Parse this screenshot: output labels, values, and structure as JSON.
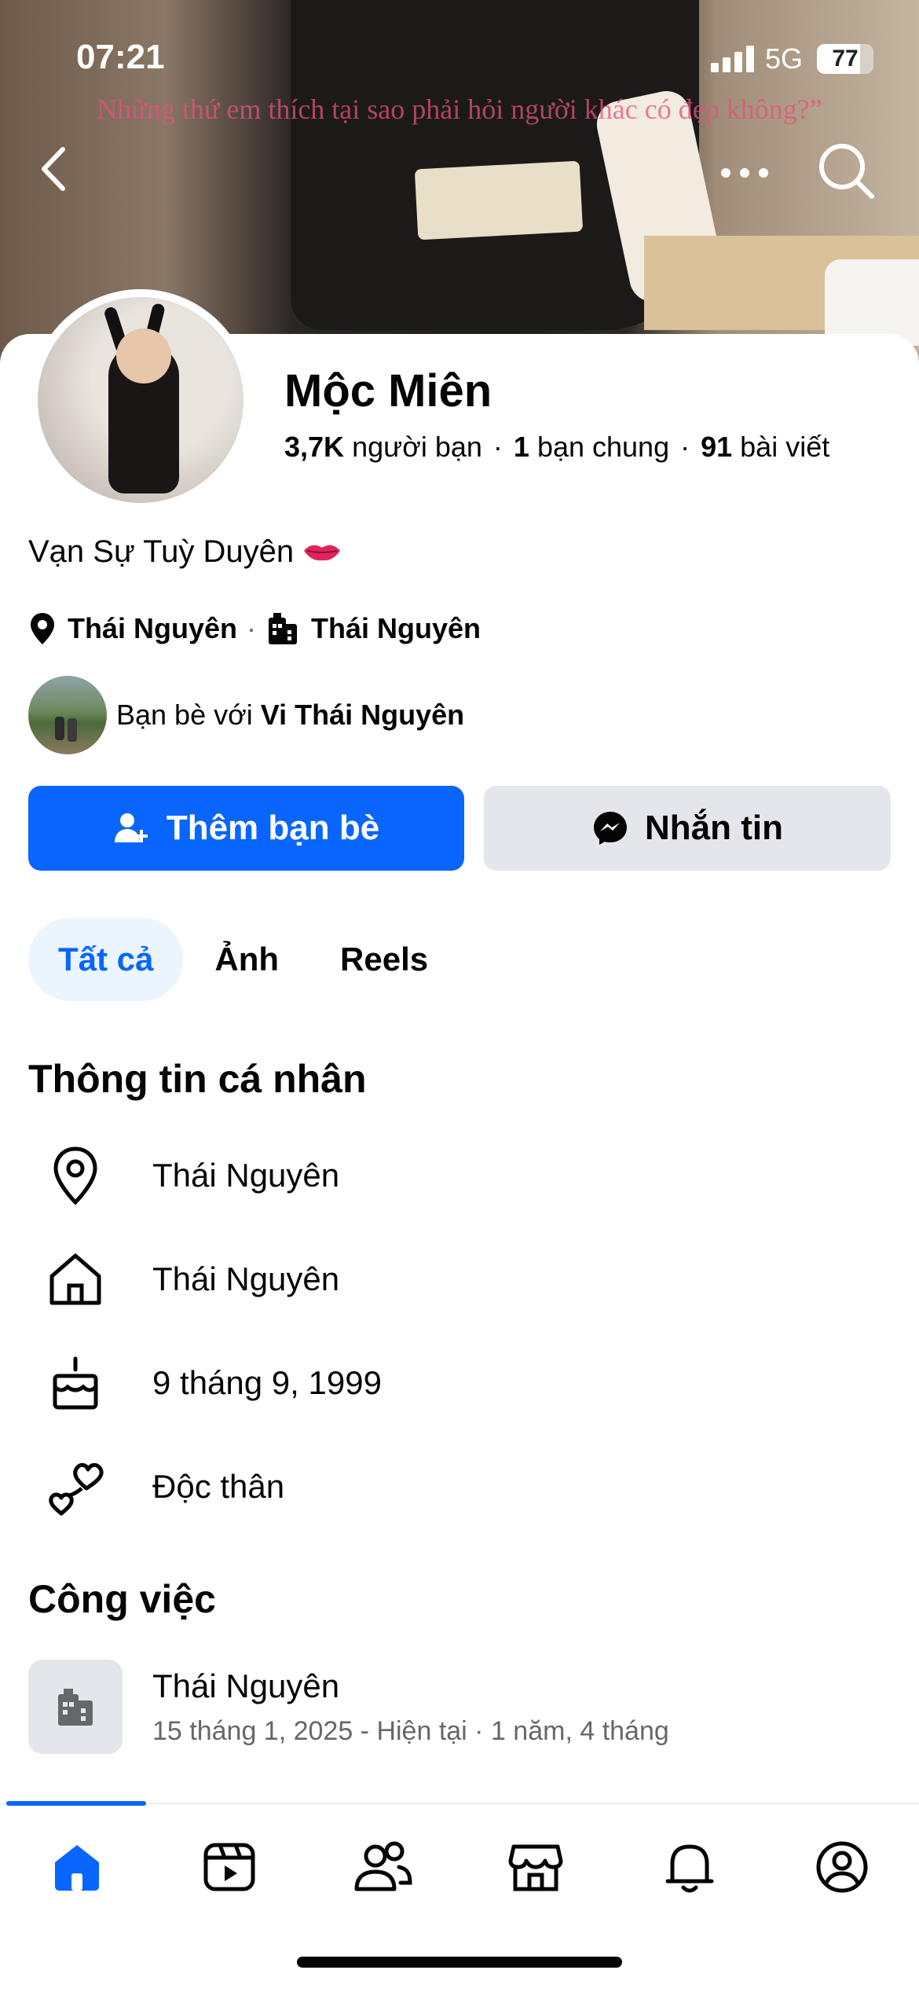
{
  "status_bar": {
    "time": "07:21",
    "network": "5G",
    "battery": "77"
  },
  "cover": {
    "caption": "Những thứ em thích tại sao phải hỏi người khác có đẹp không?”"
  },
  "profile": {
    "name": "Mộc Miên",
    "friends_count": "3,7K",
    "friends_label": "người bạn",
    "mutual_count": "1",
    "mutual_label": "bạn chung",
    "posts_count": "91",
    "posts_label": "bài viết",
    "bio": "Vạn Sự Tuỳ Duyên",
    "location": "Thái Nguyên",
    "workplace": "Thái Nguyên",
    "friends_with_prefix": "Bạn bè với",
    "friends_with_name": "Vi Thái Nguyên"
  },
  "actions": {
    "add_friend": "Thêm bạn bè",
    "message": "Nhắn tin"
  },
  "tabs": [
    {
      "label": "Tất cả",
      "active": true
    },
    {
      "label": "Ảnh",
      "active": false
    },
    {
      "label": "Reels",
      "active": false
    }
  ],
  "personal_info": {
    "title": "Thông tin cá nhân",
    "items": [
      {
        "icon": "location-pin-icon",
        "text": "Thái Nguyên"
      },
      {
        "icon": "home-icon",
        "text": "Thái Nguyên"
      },
      {
        "icon": "birthday-cake-icon",
        "text": "9 tháng 9, 1999"
      },
      {
        "icon": "relationship-hearts-icon",
        "text": "Độc thân"
      }
    ]
  },
  "work": {
    "title": "Công việc",
    "employer": "Thái Nguyên",
    "period": "15 tháng 1, 2025 - Hiện tại · 1 năm, 4 tháng"
  },
  "bottom_nav": [
    "home-icon",
    "video-icon",
    "friends-icon",
    "marketplace-icon",
    "notifications-icon",
    "profile-icon"
  ],
  "colors": {
    "accent": "#0866ff",
    "secondary_text": "#65676b",
    "button_gray": "#e4e6eb"
  }
}
